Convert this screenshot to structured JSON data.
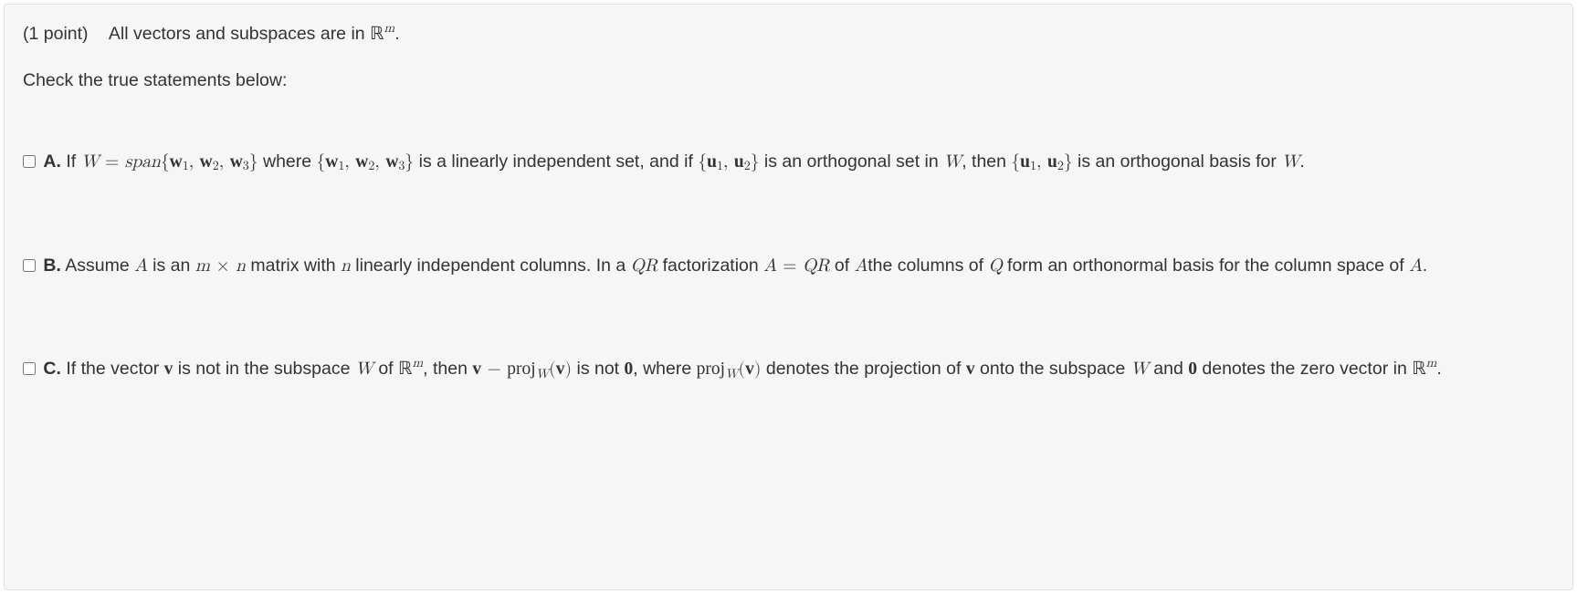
{
  "header": {
    "points": "(1 point)",
    "context_prefix": "All vectors and subspaces are in ",
    "context_math": "ℝ",
    "context_sup": "m",
    "context_suffix": "."
  },
  "instruction": "Check the true statements below:",
  "options": {
    "a": {
      "label": "A.",
      "t1": " If ",
      "W": "W",
      "eq": " = ",
      "span": "span",
      "set1_open": "{",
      "w1": "w",
      "s1": "1",
      "comma": ", ",
      "w2": "w",
      "s2": "2",
      "w3": "w",
      "s3": "3",
      "set1_close": "}",
      "t2": " where ",
      "t3": " is a linearly independent set, and if ",
      "u1": "u",
      "su1": "1",
      "u2": "u",
      "su2": "2",
      "t4": " is an orthogonal set in ",
      "t5": ", then ",
      "t6": " is an orthogonal basis for ",
      "dot": "."
    },
    "b": {
      "label": "B.",
      "t1": " Assume ",
      "A": "A",
      "t2": " is an ",
      "m": "m",
      "times": " × ",
      "n": "n",
      "t3": " matrix with ",
      "t4": " linearly independent columns. In a ",
      "QR": "QR",
      "t5": " factorization ",
      "eq": " = ",
      "t6": " of ",
      "t7": "the columns of ",
      "Q": "Q",
      "t8": " form an orthonormal basis for the column space of ",
      "dot": "."
    },
    "c": {
      "label": "C.",
      "t1": " If the vector ",
      "v": "v",
      "t2": " is not in the subspace ",
      "W": "W",
      "t3": " of ",
      "R": "ℝ",
      "m": "m",
      "t4": ", then ",
      "minus": " − ",
      "proj": "proj",
      "Wsub": "W",
      "lp": "(",
      "rp": ")",
      "t5": " is not ",
      "zero": "0",
      "t6": ", where ",
      "t7": " denotes the projection of ",
      "t8": " onto the subspace ",
      "t9": " and ",
      "t10": " denotes the zero vector in ",
      "dot": "."
    }
  }
}
